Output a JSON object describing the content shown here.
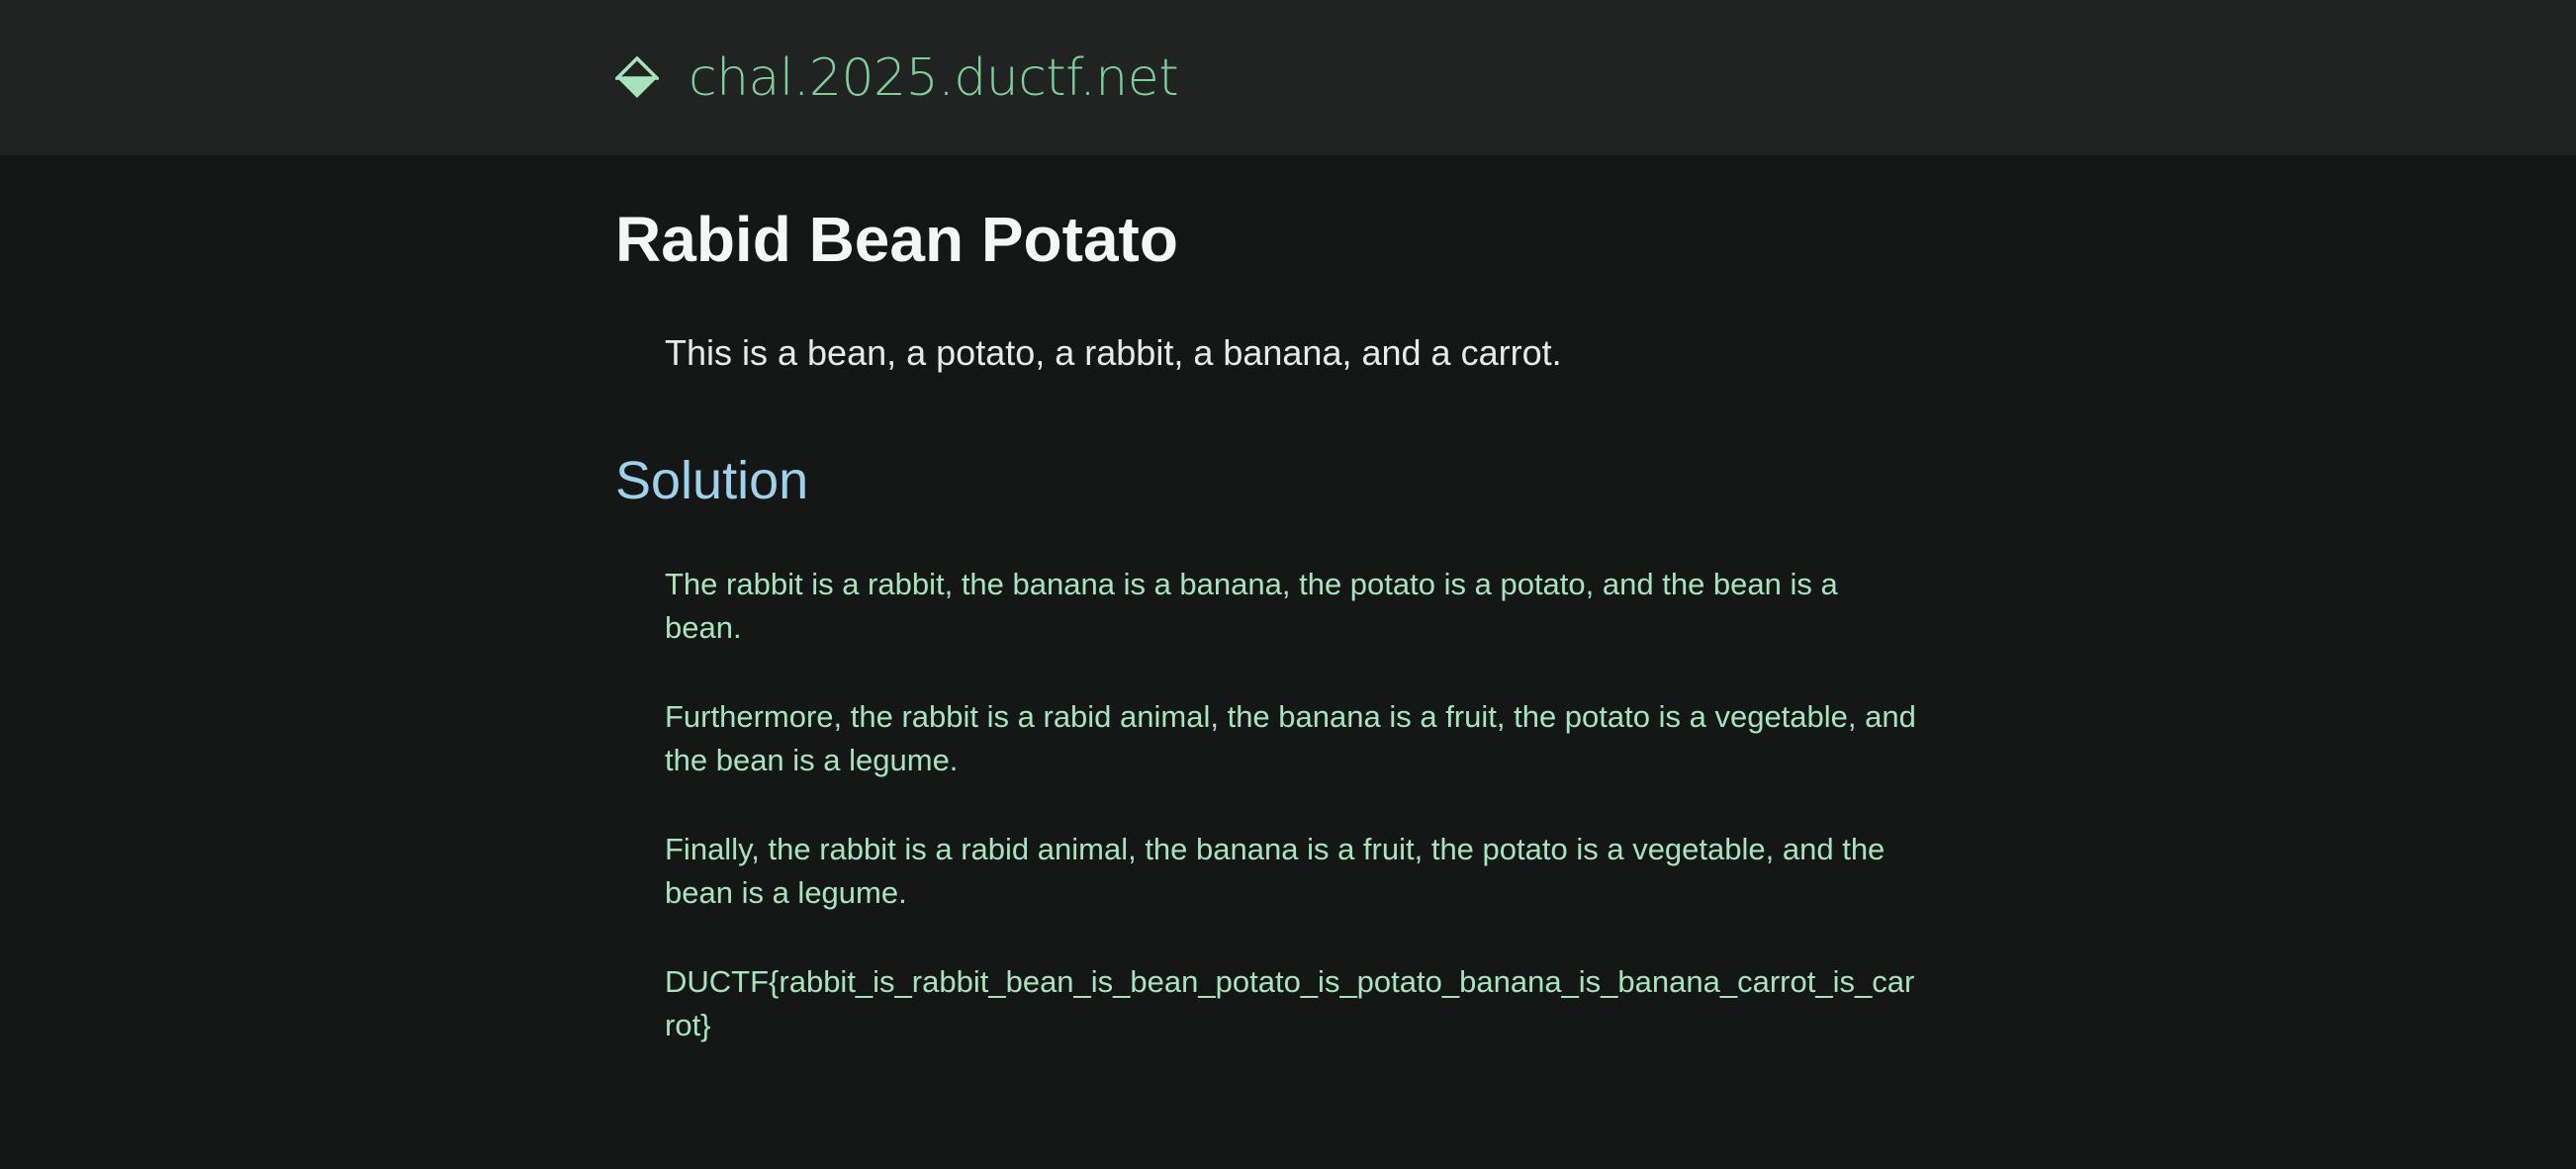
{
  "header": {
    "site_name": "chal.2025.ductf.net",
    "logo_icon": "diamond-half-icon",
    "accent_color": "#7fcf9b"
  },
  "main": {
    "title": "Rabid Bean Potato",
    "intro": "This is a bean, a potato, a rabbit, a banana, and a carrot.",
    "section_heading": "Solution",
    "paragraphs": [
      "The rabbit is a rabbit, the banana is a banana, the potato is a potato, and the bean is a bean.",
      "Furthermore, the rabbit is a rabid animal, the banana is a fruit, the potato is a vegetable, and the bean is a legume.",
      "Finally, the rabbit is a rabid animal, the banana is a fruit, the potato is a vegetable, and the bean is a legume."
    ],
    "flag": "DUCTF{rabbit_is_rabbit_bean_is_bean_potato_is_potato_banana_is_banana_carrot_is_carrot}"
  }
}
